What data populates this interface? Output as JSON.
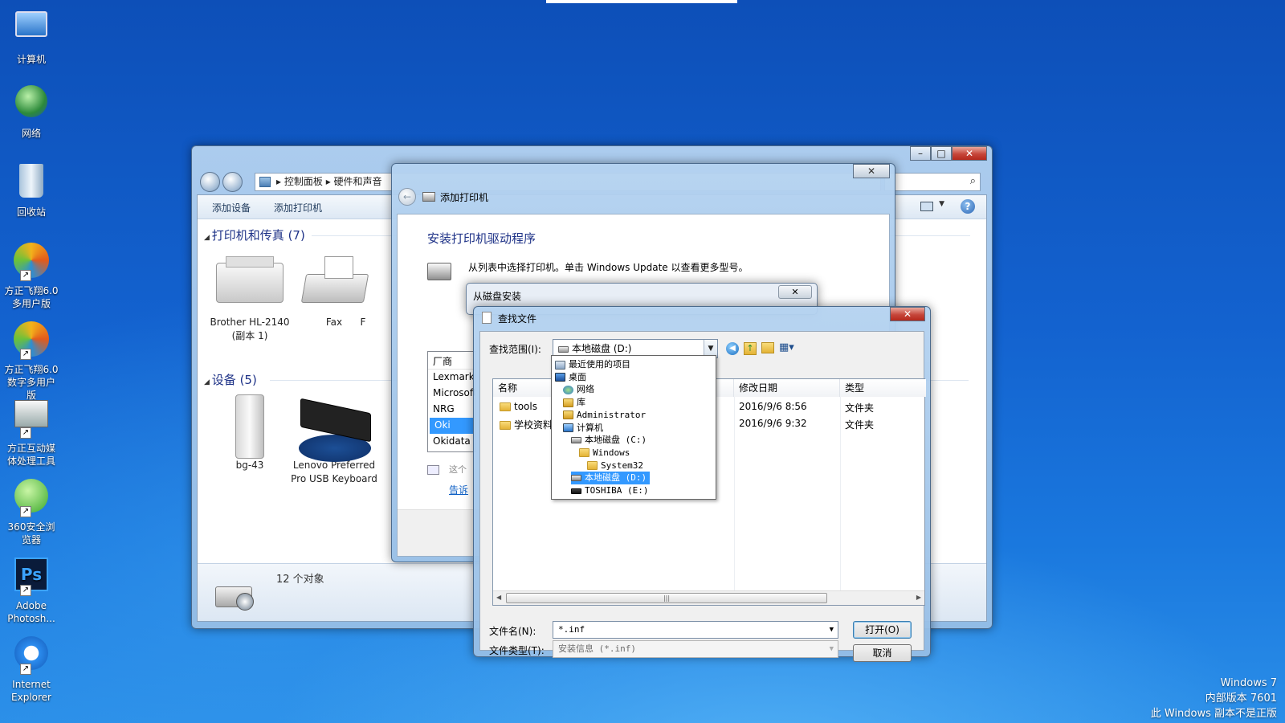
{
  "desktop": {
    "icons": [
      {
        "label": "计算机",
        "icon": "computer-icon"
      },
      {
        "label": "网络",
        "icon": "network-icon"
      },
      {
        "label": "回收站",
        "icon": "recycle-bin-icon"
      },
      {
        "label": "方正飞翔6.0多用户版",
        "icon": "founder-feixiang-icon"
      },
      {
        "label": "方正飞翔6.0数字多用户版",
        "icon": "founder-feixiang-digital-icon"
      },
      {
        "label": "方正互动媒体处理工具",
        "icon": "founder-media-tool-icon"
      },
      {
        "label": "360安全浏览器",
        "icon": "360-browser-icon"
      },
      {
        "label": "Adobe Photosh...",
        "icon": "photoshop-icon"
      },
      {
        "label": "Internet Explorer",
        "icon": "internet-explorer-icon"
      }
    ],
    "watermark": [
      "Windows 7",
      "内部版本 7601",
      "此 Windows 副本不是正版"
    ]
  },
  "control_panel": {
    "breadcrumb": [
      "控制面板",
      "硬件和声音"
    ],
    "toolbar": {
      "add_device": "添加设备",
      "add_printer": "添加打印机"
    },
    "groups": {
      "printers": "打印机和传真 (7)",
      "devices": "设备 (5)"
    },
    "printers": [
      "Brother HL-2140 (副本 1)",
      "Fax",
      "F"
    ],
    "devices": [
      "bg-43",
      "Lenovo Preferred Pro USB Keyboard"
    ],
    "status": "12 个对象"
  },
  "wizard": {
    "title": "添加打印机",
    "heading": "安装打印机驱动程序",
    "instruction": "从列表中选择打印机。单击 Windows Update 以查看更多型号。",
    "manufacturer_header": "厂商",
    "manufacturers": [
      "Lexmark",
      "Microsoft",
      "NRG",
      "Oki",
      "Okidata"
    ],
    "selected_manufacturer": "Oki",
    "signed_note": "这个",
    "link": "告诉"
  },
  "disk_dialog": {
    "title": "从磁盘安装"
  },
  "find_dialog": {
    "title": "查找文件",
    "look_in_label": "查找范围(I):",
    "look_in_value": "本地磁盘 (D:)",
    "columns": {
      "name": "名称",
      "modified": "修改日期",
      "type": "类型"
    },
    "files": [
      {
        "name": "tools",
        "modified": "2016/9/6 8:56",
        "type": "文件夹"
      },
      {
        "name": "学校资料",
        "modified": "2016/9/6 9:32",
        "type": "文件夹"
      }
    ],
    "filename_label": "文件名(N):",
    "filename_value": "*.inf",
    "filetype_label": "文件类型(T):",
    "filetype_value": "安装信息 (*.inf)",
    "open_button": "打开(O)",
    "cancel_button": "取消"
  },
  "dropdown": {
    "items": [
      {
        "label": "最近使用的项目",
        "icon": "recent-items-icon",
        "indent": 0
      },
      {
        "label": "桌面",
        "icon": "desktop-icon",
        "indent": 0
      },
      {
        "label": "网络",
        "icon": "network-icon",
        "indent": 1
      },
      {
        "label": "库",
        "icon": "library-icon",
        "indent": 1
      },
      {
        "label": "Administrator",
        "icon": "user-folder-icon",
        "indent": 1
      },
      {
        "label": "计算机",
        "icon": "computer-icon",
        "indent": 1
      },
      {
        "label": "本地磁盘 (C:)",
        "icon": "drive-c-icon",
        "indent": 2
      },
      {
        "label": "Windows",
        "icon": "folder-icon",
        "indent": 3
      },
      {
        "label": "System32",
        "icon": "folder-icon",
        "indent": 4
      },
      {
        "label": "本地磁盘 (D:)",
        "icon": "drive-d-icon",
        "indent": 2,
        "selected": true
      },
      {
        "label": "TOSHIBA (E:)",
        "icon": "usb-drive-icon",
        "indent": 2
      }
    ]
  },
  "colors": {
    "accent": "#3399ff",
    "link": "#1e3287",
    "desktop": "#1362cf"
  }
}
